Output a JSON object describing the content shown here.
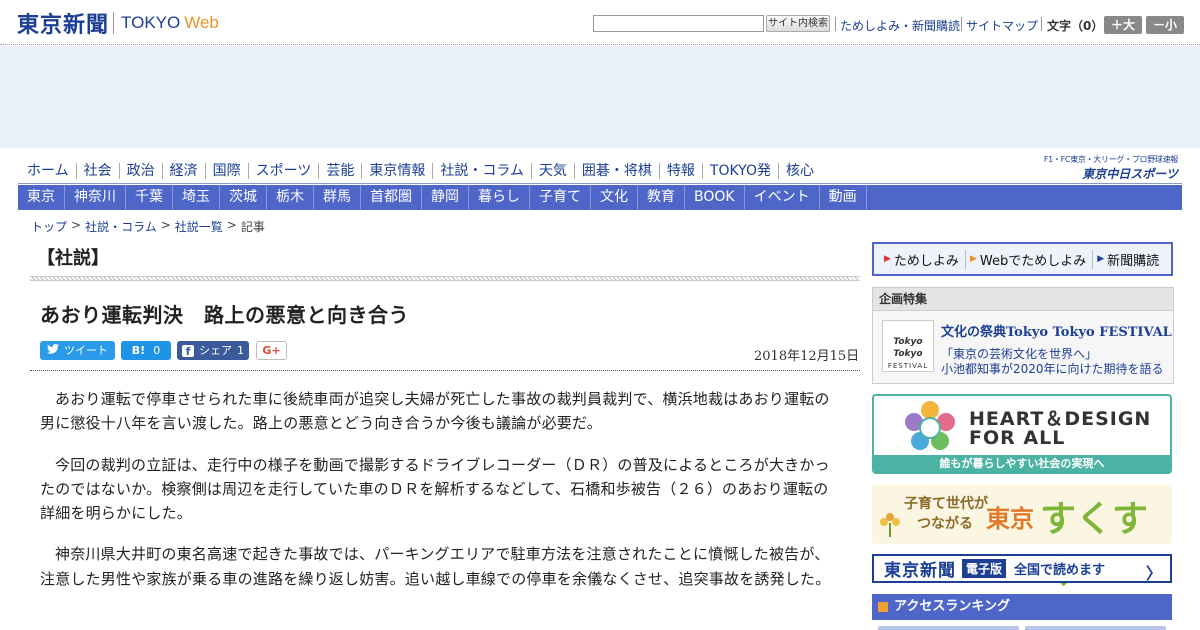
{
  "header": {
    "logo_jp": "東京新聞",
    "logo_en": "TOKYO",
    "logo_web": "Web",
    "search_button": "サイト内検索",
    "links": [
      "ためしよみ・新聞購読",
      "サイトマップ"
    ],
    "font_size_label": "文字（0）",
    "font_bigger": "＋大",
    "font_smaller": "－小"
  },
  "nav_primary": [
    "ホーム",
    "社会",
    "政治",
    "経済",
    "国際",
    "スポーツ",
    "芸能",
    "東京情報",
    "社説・コラム",
    "天気",
    "囲碁・将棋",
    "特報",
    "TOKYO発",
    "核心"
  ],
  "chunichi_sports": {
    "small": "F1・FC東京・大リーグ・プロ野球速報",
    "big": "東京中日スポーツ"
  },
  "nav_regional": [
    "東京",
    "神奈川",
    "千葉",
    "埼玉",
    "茨城",
    "栃木",
    "群馬",
    "首都圏",
    "静岡",
    "暮らし",
    "子育て",
    "文化",
    "教育",
    "BOOK",
    "イベント",
    "動画"
  ],
  "breadcrumb": {
    "items": [
      "トップ",
      "社説・コラム",
      "社説一覧"
    ],
    "current": "記事",
    "sep": ">"
  },
  "section_title": "【社説】",
  "article": {
    "headline": "あおり運転判決　路上の悪意と向き合う",
    "date": "2018年12月15日",
    "paragraphs": [
      "あおり運転で停車させられた車に後続車両が追突し夫婦が死亡した事故の裁判員裁判で、横浜地裁はあおり運転の男に懲役十八年を言い渡した。路上の悪意とどう向き合うか今後も議論が必要だ。",
      "今回の裁判の立証は、走行中の様子を動画で撮影するドライブレコーダー（ＤＲ）の普及によるところが大きかったのではないか。検察側は周辺を走行していた車のＤＲを解析するなどして、石橋和歩被告（２６）のあおり運転の詳細を明らかにした。",
      "神奈川県大井町の東名高速で起きた事故では、パーキングエリアで駐車方法を注意されたことに憤慨した被告が、注意した男性や家族が乗る車の進路を繰り返し妨害。追い越し車線での停車を余儀なくさせ、追突事故を誘発した。"
    ]
  },
  "share": {
    "tweet": "ツイート",
    "hatena_icon": "B!",
    "hatena_count": "0",
    "facebook_icon": "f",
    "facebook_label": "シェア",
    "facebook_count": "1",
    "gplus": "G+"
  },
  "sidebar": {
    "subnav": [
      "ためしよみ",
      "Webでためしよみ",
      "新聞購読"
    ],
    "kikaku": {
      "heading": "企画特集",
      "thumb_line1": "Tokyo Tokyo",
      "thumb_line2": "FESTIVAL",
      "title": "文化の祭典Tokyo Tokyo FESTIVAL",
      "sub1": "「東京の芸術文化を世界へ」",
      "sub2": "小池都知事が2020年に向けた期待を語る"
    },
    "heart_design": {
      "line1": "HEART＆DESIGN",
      "line2": "FOR ALL",
      "band": "誰もが暮らしやすい社会の実現へ"
    },
    "sukusuku": {
      "small1": "子育て世代が",
      "small2": "つながる",
      "tokyo": "東京",
      "big": "すくすく"
    },
    "denshi": {
      "name": "東京新聞",
      "tag": "電子版",
      "text": "全国で読めます",
      "arrow": "〉"
    },
    "ranking": "アクセスランキング"
  },
  "colors": {
    "brand_navy": "#1c3f94",
    "nav_blue": "#4f66c9",
    "web_orange": "#e8932a",
    "heart_teal": "#4ab3a3"
  }
}
